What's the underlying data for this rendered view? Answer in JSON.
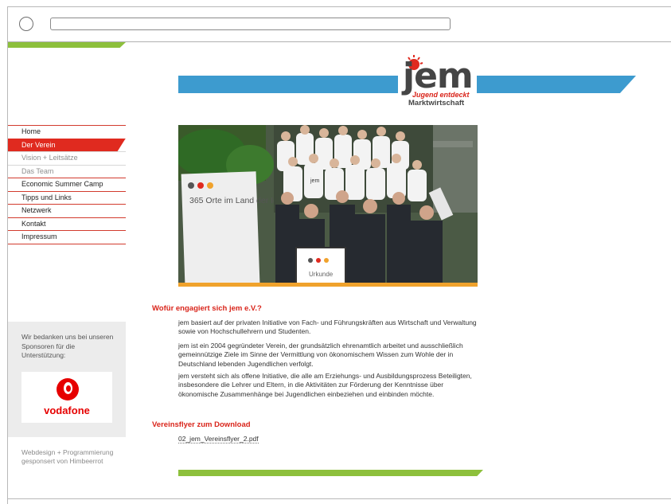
{
  "nav": {
    "items": [
      {
        "label": "Home"
      },
      {
        "label": "Der Verein"
      },
      {
        "label": "Vision + Leitsätze"
      },
      {
        "label": "Das Team"
      },
      {
        "label": "Economic Summer Camp"
      },
      {
        "label": "Tipps und Links"
      },
      {
        "label": "Netzwerk"
      },
      {
        "label": "Kontakt"
      },
      {
        "label": "Impressum"
      }
    ]
  },
  "logo": {
    "word": "jem",
    "tagline_1": "Jugend entdeckt",
    "tagline_2": "Marktwirtschaft"
  },
  "photo": {
    "banner_text": "365 Orte im Land der Ideen.",
    "certificate_text": "Urkunde",
    "shirt_text": "jem"
  },
  "sponsor": {
    "thanks_text": "Wir bedanken uns bei unseren Sponsoren für die Unterstützung:",
    "sponsor_name": "vodafone"
  },
  "credits": "Webdesign + Programmierung gesponsert von Himbeerrot",
  "content": {
    "heading_1": "Wofür engagiert sich jem e.V.?",
    "paragraphs": [
      "jem basiert auf der privaten Initiative von Fach- und Führungskräften aus Wirtschaft und Verwaltung sowie von Hochschullehrern und Studenten.",
      "jem ist ein 2004 gegründeter Verein, der grundsätzlich ehrenamtlich arbeitet und ausschließlich gemeinnützige Ziele im Sinne der Vermittlung von ökonomischem Wissen zum Wohle der in Deutschland lebenden Jugendlichen verfolgt.",
      "jem versteht sich als offene Initiative, die alle am Erziehungs- und Ausbildungsprozess Beteiligten, insbesondere die Lehrer und Eltern, in die Aktivitäten zur Förderung der Kenntnisse über ökonomische Zusammenhänge bei Jugendlichen einbeziehen und einbinden möchte."
    ],
    "heading_2": "Vereinsflyer zum Download",
    "download_link": "02_jem_Vereinsflyer_2.pdf"
  },
  "colors": {
    "accent_red": "#e02a1f",
    "accent_green": "#8dc03c",
    "accent_blue": "#3d9bcf",
    "accent_orange": "#f0a22c"
  }
}
